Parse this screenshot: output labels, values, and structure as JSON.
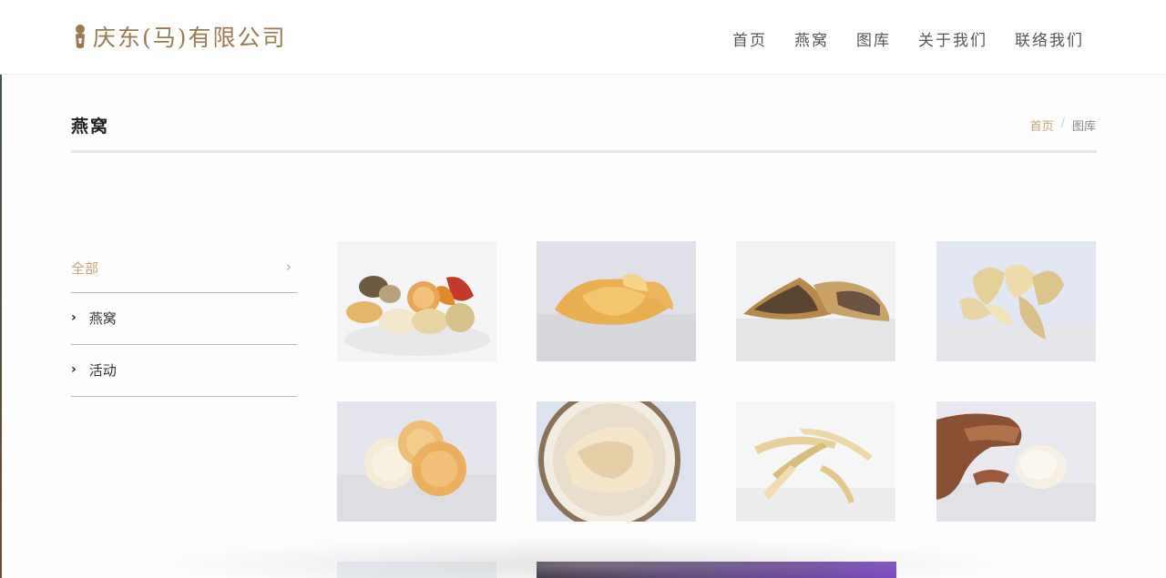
{
  "header": {
    "logo_text": "庆东(马)有限公司",
    "nav": [
      "首页",
      "燕窝",
      "图库",
      "关于我们",
      "联络我们"
    ]
  },
  "page": {
    "title": "燕窝",
    "breadcrumb": {
      "home": "首页",
      "sep": "/",
      "current": "图库"
    }
  },
  "sidebar": {
    "items": [
      {
        "label": "全部",
        "active": true,
        "icon": "chevron-right-icon"
      },
      {
        "label": "燕窝",
        "active": false,
        "icon": "chevron-right-icon"
      },
      {
        "label": "活动",
        "active": false,
        "icon": "chevron-right-icon"
      }
    ]
  },
  "gallery": {
    "images": [
      "mixed-birdnest-assortment",
      "golden-birdnest-cup",
      "dark-triangle-birdnest",
      "white-birdnest-strips",
      "round-birdnest-cakes",
      "shredded-birdnest-plate",
      "birdnest-strips-pile",
      "hand-holding-birdnest",
      "partial-thumbnail",
      "purple-banner-thumbnail"
    ]
  },
  "colors": {
    "accent": "#c4a27a",
    "logo": "#9a7a52",
    "nav_text": "#555555",
    "divider": "#e6e6e6"
  }
}
